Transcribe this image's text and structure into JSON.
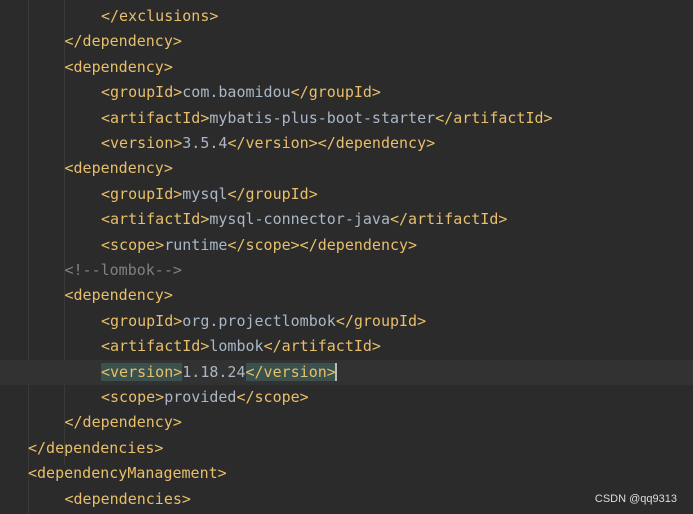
{
  "editor": {
    "lines": [
      {
        "indent": 3,
        "parts": [
          {
            "k": "tag",
            "t": "</exclusions>"
          }
        ]
      },
      {
        "indent": 2,
        "parts": [
          {
            "k": "tag",
            "t": "</dependency>"
          }
        ]
      },
      {
        "indent": 2,
        "parts": [
          {
            "k": "tag",
            "t": "<dependency>"
          }
        ]
      },
      {
        "indent": 3,
        "parts": [
          {
            "k": "tag",
            "t": "<groupId>"
          },
          {
            "k": "txt",
            "t": "com.baomidou"
          },
          {
            "k": "tag",
            "t": "</groupId>"
          }
        ]
      },
      {
        "indent": 3,
        "parts": [
          {
            "k": "tag",
            "t": "<artifactId>"
          },
          {
            "k": "txt",
            "t": "mybatis-plus-boot-starter"
          },
          {
            "k": "tag",
            "t": "</artifactId>"
          }
        ]
      },
      {
        "indent": 3,
        "parts": [
          {
            "k": "tag",
            "t": "<version>"
          },
          {
            "k": "txt",
            "t": "3.5.4"
          },
          {
            "k": "tag",
            "t": "</version></dependency>"
          }
        ]
      },
      {
        "indent": 2,
        "parts": [
          {
            "k": "tag",
            "t": "<dependency>"
          }
        ]
      },
      {
        "indent": 3,
        "parts": [
          {
            "k": "tag",
            "t": "<groupId>"
          },
          {
            "k": "txt",
            "t": "mysql"
          },
          {
            "k": "tag",
            "t": "</groupId>"
          }
        ]
      },
      {
        "indent": 3,
        "parts": [
          {
            "k": "tag",
            "t": "<artifactId>"
          },
          {
            "k": "txt",
            "t": "mysql-connector-java"
          },
          {
            "k": "tag",
            "t": "</artifactId>"
          }
        ]
      },
      {
        "indent": 3,
        "parts": [
          {
            "k": "tag",
            "t": "<scope>"
          },
          {
            "k": "txt",
            "t": "runtime"
          },
          {
            "k": "tag",
            "t": "</scope></dependency>"
          }
        ]
      },
      {
        "indent": 2,
        "parts": [
          {
            "k": "cmt",
            "t": "<!--lombok-->"
          }
        ]
      },
      {
        "indent": 2,
        "parts": [
          {
            "k": "tag",
            "t": "<dependency>"
          }
        ]
      },
      {
        "indent": 3,
        "parts": [
          {
            "k": "tag",
            "t": "<groupId>"
          },
          {
            "k": "txt",
            "t": "org.projectlombok"
          },
          {
            "k": "tag",
            "t": "</groupId>"
          }
        ]
      },
      {
        "indent": 3,
        "parts": [
          {
            "k": "tag",
            "t": "<artifactId>"
          },
          {
            "k": "txt",
            "t": "lombok"
          },
          {
            "k": "tag",
            "t": "</artifactId>"
          }
        ]
      },
      {
        "indent": 3,
        "current": true,
        "parts": [
          {
            "k": "tag hl",
            "t": "<version>"
          },
          {
            "k": "txt",
            "t": "1.18.24"
          },
          {
            "k": "tag hl",
            "t": "</version>"
          },
          {
            "k": "caret",
            "t": ""
          }
        ]
      },
      {
        "indent": 3,
        "parts": [
          {
            "k": "tag",
            "t": "<scope>"
          },
          {
            "k": "txt",
            "t": "provided"
          },
          {
            "k": "tag",
            "t": "</scope>"
          }
        ]
      },
      {
        "indent": 2,
        "parts": [
          {
            "k": "tag",
            "t": "</dependency>"
          }
        ]
      },
      {
        "indent": 1,
        "parts": [
          {
            "k": "tag",
            "t": "</dependencies>"
          }
        ]
      },
      {
        "indent": 1,
        "parts": [
          {
            "k": "tag",
            "t": "<dependencyManagement>"
          }
        ]
      },
      {
        "indent": 2,
        "parts": [
          {
            "k": "tag",
            "t": "<dependencies>"
          }
        ]
      }
    ]
  },
  "watermark": "CSDN @qq9313",
  "colors": {
    "background": "#2b2b2b",
    "tag": "#e8bf6a",
    "text": "#a9b7c6",
    "comment": "#808080",
    "current_line": "#323232",
    "tag_match_highlight": "#3b514d"
  }
}
